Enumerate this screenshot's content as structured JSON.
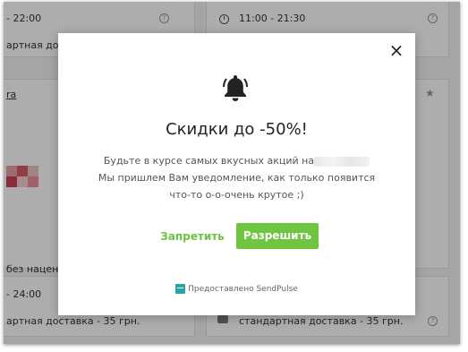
{
  "background": {
    "left_top": {
      "hours": "- 22:00",
      "delivery": "артная доставка"
    },
    "right_top": {
      "hours": "11:00 - 21:30"
    },
    "left_mid": {
      "link": "ra",
      "discount": "без наценок"
    },
    "left_bottom": {
      "hours": "- 24:00",
      "delivery": "артная доставка - 35 грн."
    },
    "right_bottom": {
      "delivery": "стандартная доставка - 35 грн."
    }
  },
  "modal": {
    "title": "Скидки до -50%!",
    "desc_line1": "Будьте в курсе самых вкусных акций на",
    "desc_line2": "Мы пришлем Вам уведомление, как только появится",
    "desc_line3": "что-то о-о-очень крутое ;)",
    "deny_label": "Запретить",
    "allow_label": "Разрешить",
    "powered_by": "Предоставлено SendPulse",
    "close_symbol": "×",
    "icons": [
      "bell-icon",
      "close-icon",
      "sendpulse-logo"
    ],
    "colors": {
      "accent": "#6fc53f",
      "logo": "#25a5a4"
    }
  }
}
